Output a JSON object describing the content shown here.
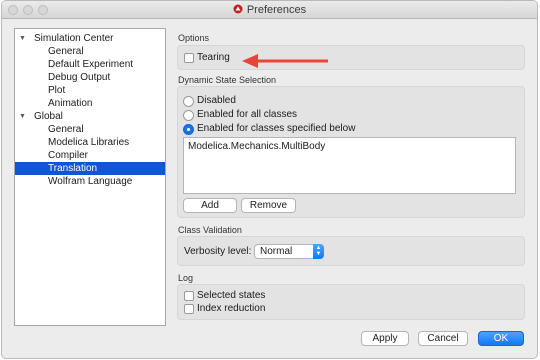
{
  "window": {
    "title": "Preferences"
  },
  "sidebar": {
    "items": [
      {
        "label": "Simulation Center",
        "level": 0,
        "expanded": true,
        "selected": false
      },
      {
        "label": "General",
        "level": 1,
        "selected": false
      },
      {
        "label": "Default Experiment",
        "level": 1,
        "selected": false
      },
      {
        "label": "Debug Output",
        "level": 1,
        "selected": false
      },
      {
        "label": "Plot",
        "level": 1,
        "selected": false
      },
      {
        "label": "Animation",
        "level": 1,
        "selected": false
      },
      {
        "label": "Global",
        "level": 0,
        "expanded": true,
        "selected": false
      },
      {
        "label": "General",
        "level": 1,
        "selected": false
      },
      {
        "label": "Modelica Libraries",
        "level": 1,
        "selected": false
      },
      {
        "label": "Compiler",
        "level": 1,
        "selected": false
      },
      {
        "label": "Translation",
        "level": 1,
        "selected": true
      },
      {
        "label": "Wolfram Language",
        "level": 1,
        "selected": false
      }
    ]
  },
  "options": {
    "section_label": "Options",
    "tearing_label": "Tearing",
    "tearing_checked": false
  },
  "dynamic_state": {
    "section_label": "Dynamic State Selection",
    "radios": [
      {
        "label": "Disabled",
        "selected": false
      },
      {
        "label": "Enabled for all classes",
        "selected": false
      },
      {
        "label": "Enabled for classes specified below",
        "selected": true
      }
    ],
    "classes": [
      "Modelica.Mechanics.MultiBody"
    ],
    "add_label": "Add",
    "remove_label": "Remove"
  },
  "class_validation": {
    "section_label": "Class Validation",
    "verbosity_label": "Verbosity level:",
    "verbosity_value": "Normal"
  },
  "log": {
    "section_label": "Log",
    "items": [
      {
        "label": "Selected states",
        "checked": false
      },
      {
        "label": "Index reduction",
        "checked": false
      }
    ]
  },
  "footer": {
    "apply_label": "Apply",
    "cancel_label": "Cancel",
    "ok_label": "OK"
  },
  "colors": {
    "accent": "#1478f5",
    "selection": "#1054d8",
    "annotation_arrow": "#e8443a"
  },
  "icons": [
    "app-logo-icon",
    "disclosure-triangle-icon",
    "stepper-icon",
    "annotation-arrow-icon"
  ]
}
